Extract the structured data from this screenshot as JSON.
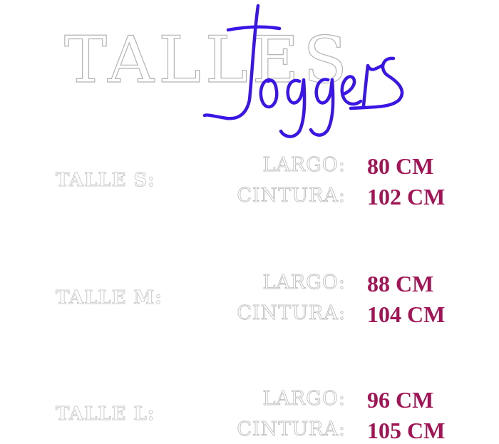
{
  "heading": "TALLES",
  "script_title": "Joggers",
  "colors": {
    "accent": "#a31456",
    "script": "#3b15e6",
    "outline_text": "#c0c0c0",
    "background": "#ffffff"
  },
  "sizes": [
    {
      "label": "TALLE S:",
      "largo_label": "LARGO:",
      "largo_value": "80 CM",
      "cintura_label": "CINTURA:",
      "cintura_value": "102 CM"
    },
    {
      "label": "TALLE M:",
      "largo_label": "LARGO:",
      "largo_value": "88 CM",
      "cintura_label": "CINTURA:",
      "cintura_value": "104 CM"
    },
    {
      "label": "TALLE L:",
      "largo_label": "LARGO:",
      "largo_value": "96 CM",
      "cintura_label": "CINTURA:",
      "cintura_value": "105 CM"
    }
  ]
}
